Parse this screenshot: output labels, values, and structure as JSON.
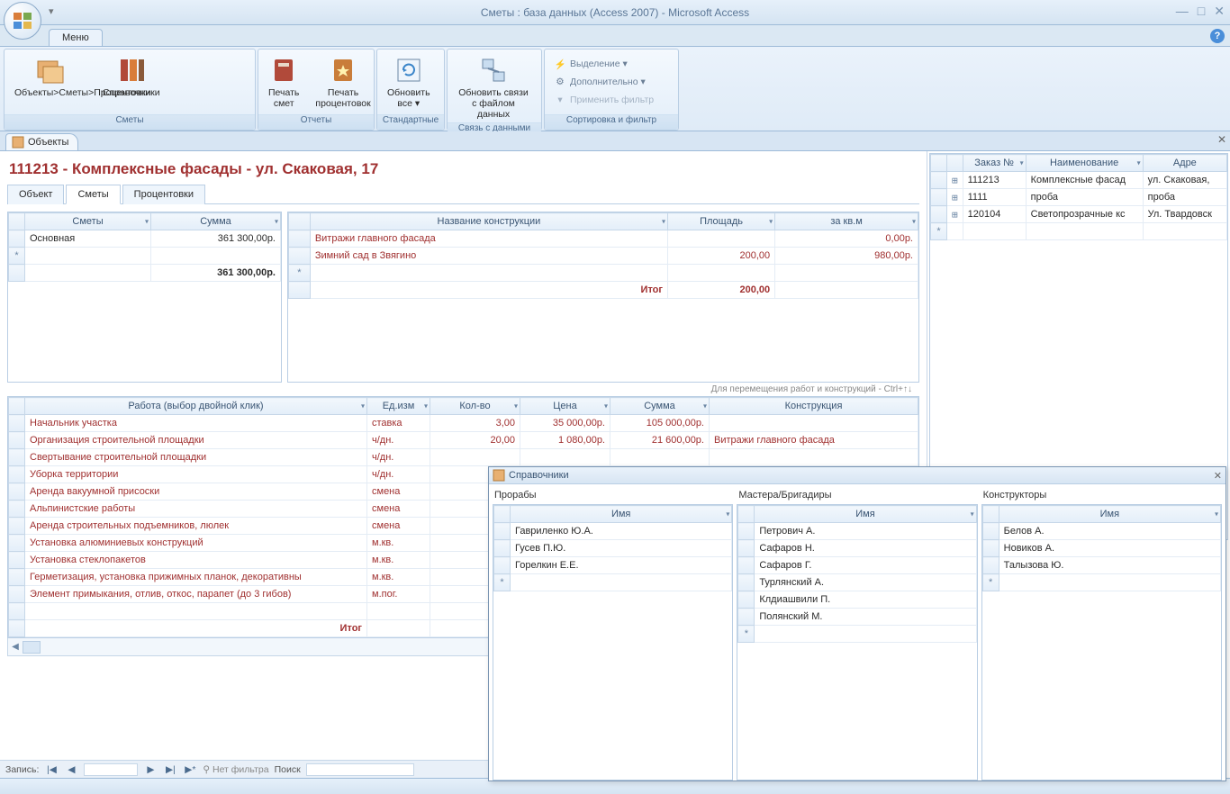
{
  "window": {
    "title": "Сметы : база данных (Access 2007)  -  Microsoft Access",
    "tab_menu": "Меню",
    "doc_tab": "Объекты"
  },
  "ribbon": {
    "groups": [
      {
        "key": "smety",
        "label": "Сметы",
        "buttons": [
          {
            "key": "objects",
            "label": "Объекты>Сметы>Процентовки",
            "icon": "table-icon"
          },
          {
            "key": "sprav",
            "label": "Справочники",
            "icon": "books-icon"
          }
        ]
      },
      {
        "key": "otchety",
        "label": "Отчеты",
        "buttons": [
          {
            "key": "print_smet",
            "label": "Печать\nсмет",
            "icon": "book-red-icon"
          },
          {
            "key": "print_proc",
            "label": "Печать\nпроцентовок",
            "icon": "book-star-icon"
          }
        ]
      },
      {
        "key": "standard",
        "label": "Стандартные",
        "buttons": [
          {
            "key": "refresh",
            "label": "Обновить\nвсе ▾",
            "icon": "refresh-icon"
          }
        ]
      },
      {
        "key": "svyaz",
        "label": "Связь с данными",
        "buttons": [
          {
            "key": "links",
            "label": "Обновить связи\nс файлом данных",
            "icon": "link-icon"
          }
        ]
      },
      {
        "key": "sortfilter",
        "label": "Сортировка и фильтр",
        "small": [
          {
            "key": "selection",
            "label": "Выделение ▾",
            "icon": "funnel-lightning"
          },
          {
            "key": "extra",
            "label": "Дополнительно ▾",
            "icon": "funnel-gear"
          },
          {
            "key": "applyfilter",
            "label": "Применить фильтр",
            "icon": "funnel"
          }
        ]
      }
    ]
  },
  "page": {
    "title": "111213 - Комплексные фасады - ул. Скаковая, 17",
    "subtabs": [
      "Объект",
      "Сметы",
      "Процентовки"
    ],
    "active_subtab": 1
  },
  "smeta_grid": {
    "headers": [
      "Сметы",
      "Сумма"
    ],
    "rows": [
      {
        "name": "Основная",
        "sum": "361 300,00р."
      }
    ],
    "total": "361 300,00р."
  },
  "constr_grid": {
    "headers": [
      "Название конструкции",
      "Площадь",
      "за кв.м"
    ],
    "rows": [
      {
        "name": "Витражи главного фасада",
        "area": "",
        "price": "0,00р."
      },
      {
        "name": "Зимний сад в Звягино",
        "area": "200,00",
        "price": "980,00р."
      }
    ],
    "total_label": "Итог",
    "total_area": "200,00"
  },
  "hint": "Для перемещения работ и конструкций - Ctrl+↑↓",
  "works_grid": {
    "headers": [
      "Работа (выбор двойной клик)",
      "Ед.изм",
      "Кол-во",
      "Цена",
      "Сумма",
      "Конструкция"
    ],
    "rows": [
      {
        "name": "Начальник участка",
        "unit": "ставка",
        "qty": "3,00",
        "price": "35 000,00р.",
        "sum": "105 000,00р.",
        "constr": ""
      },
      {
        "name": "Организация строительной площадки",
        "unit": "ч/дн.",
        "qty": "20,00",
        "price": "1 080,00р.",
        "sum": "21 600,00р.",
        "constr": "Витражи главного фасада"
      },
      {
        "name": "Свертывание строительной площадки",
        "unit": "ч/дн.",
        "qty": "",
        "price": "",
        "sum": "",
        "constr": ""
      },
      {
        "name": "Уборка территории",
        "unit": "ч/дн.",
        "qty": "",
        "price": "",
        "sum": "",
        "constr": ""
      },
      {
        "name": "Аренда вакуумной присоски",
        "unit": "смена",
        "qty": "",
        "price": "",
        "sum": "",
        "constr": ""
      },
      {
        "name": "Альпинистские работы",
        "unit": "смена",
        "qty": "",
        "price": "",
        "sum": "",
        "constr": ""
      },
      {
        "name": "Аренда строительных подъемников, люлек",
        "unit": "смена",
        "qty": "",
        "price": "",
        "sum": "",
        "constr": ""
      },
      {
        "name": "Установка алюминиевых конструкций",
        "unit": "м.кв.",
        "qty": "",
        "price": "",
        "sum": "",
        "constr": ""
      },
      {
        "name": "Установка стеклопакетов",
        "unit": "м.кв.",
        "qty": "",
        "price": "",
        "sum": "",
        "constr": ""
      },
      {
        "name": "Герметизация, установка прижимных планок, декоративны",
        "unit": "м.кв.",
        "qty": "",
        "price": "",
        "sum": "",
        "constr": ""
      },
      {
        "name": "Элемент примыкания, отлив, откос, парапет (до 3 гибов)",
        "unit": "м.пог.",
        "qty": "",
        "price": "",
        "sum": "",
        "constr": ""
      }
    ],
    "total_label": "Итог"
  },
  "recnav": {
    "label": "Запись:",
    "pos": "",
    "nofilter": "Нет фильтра",
    "search_label": "Поиск"
  },
  "right_grid": {
    "headers": [
      "Заказ №",
      "Наименование",
      "Адре"
    ],
    "rows": [
      {
        "num": "111213",
        "name": "Комплексные фасад",
        "addr": "ул. Скаковая,"
      },
      {
        "num": "1111",
        "name": "проба",
        "addr": "проба"
      },
      {
        "num": "120104",
        "name": "Светопрозрачные кс",
        "addr": "Ул. Твардовск"
      }
    ]
  },
  "popup": {
    "title": "Справочники",
    "cols": [
      {
        "title": "Прорабы",
        "header": "Имя",
        "rows": [
          "Гавриленко Ю.А.",
          "Гусев П.Ю.",
          "Горелкин Е.Е."
        ]
      },
      {
        "title": "Мастера/Бригадиры",
        "header": "Имя",
        "rows": [
          "Петрович А.",
          "Сафаров Н.",
          "Сафаров Г.",
          "Турлянский А.",
          "Клдиашвили П.",
          "Полянский М."
        ]
      },
      {
        "title": "Конструкторы",
        "header": "Имя",
        "rows": [
          "Белов А.",
          "Новиков А.",
          "Талызова Ю."
        ]
      }
    ]
  }
}
